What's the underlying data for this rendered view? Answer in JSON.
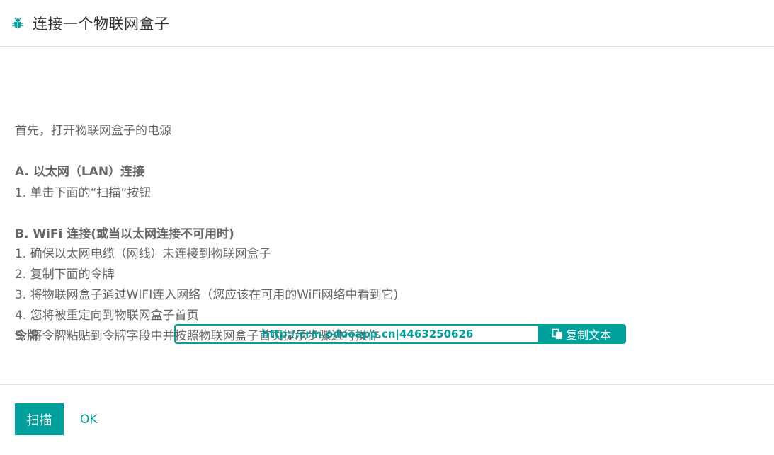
{
  "dialog": {
    "title": "连接一个物联网盒子",
    "icon": "bug-icon"
  },
  "instructions": {
    "intro": "首先，打开物联网盒子的电源",
    "section_a": {
      "heading": "A. 以太网（LAN）连接",
      "steps": [
        "1. 单击下面的“扫描”按钮"
      ]
    },
    "section_b": {
      "heading": "B. WiFi 连接(或当以太网连接不可用时)",
      "steps": [
        "1. 确保以太网电缆（网线）未连接到物联网盒子",
        "2. 复制下面的令牌",
        "3. 将物联网盒子通过WIFI连入网络（您应该在可用的WiFi网络中看到它)",
        "4. 您将被重定向到物联网盒子首页",
        "5. 将令牌粘贴到令牌字段中并按照物联网盒子首页提示步骤进行操作"
      ]
    }
  },
  "token": {
    "label": "令牌",
    "value": "http://crm.odooapp.cn|4463250626",
    "copy_label": "复制文本",
    "copy_icon": "copy-icon"
  },
  "footer": {
    "scan_label": "扫描",
    "ok_label": "OK"
  },
  "colors": {
    "accent": "#00a09d",
    "text": "#666666",
    "title": "#333333"
  }
}
